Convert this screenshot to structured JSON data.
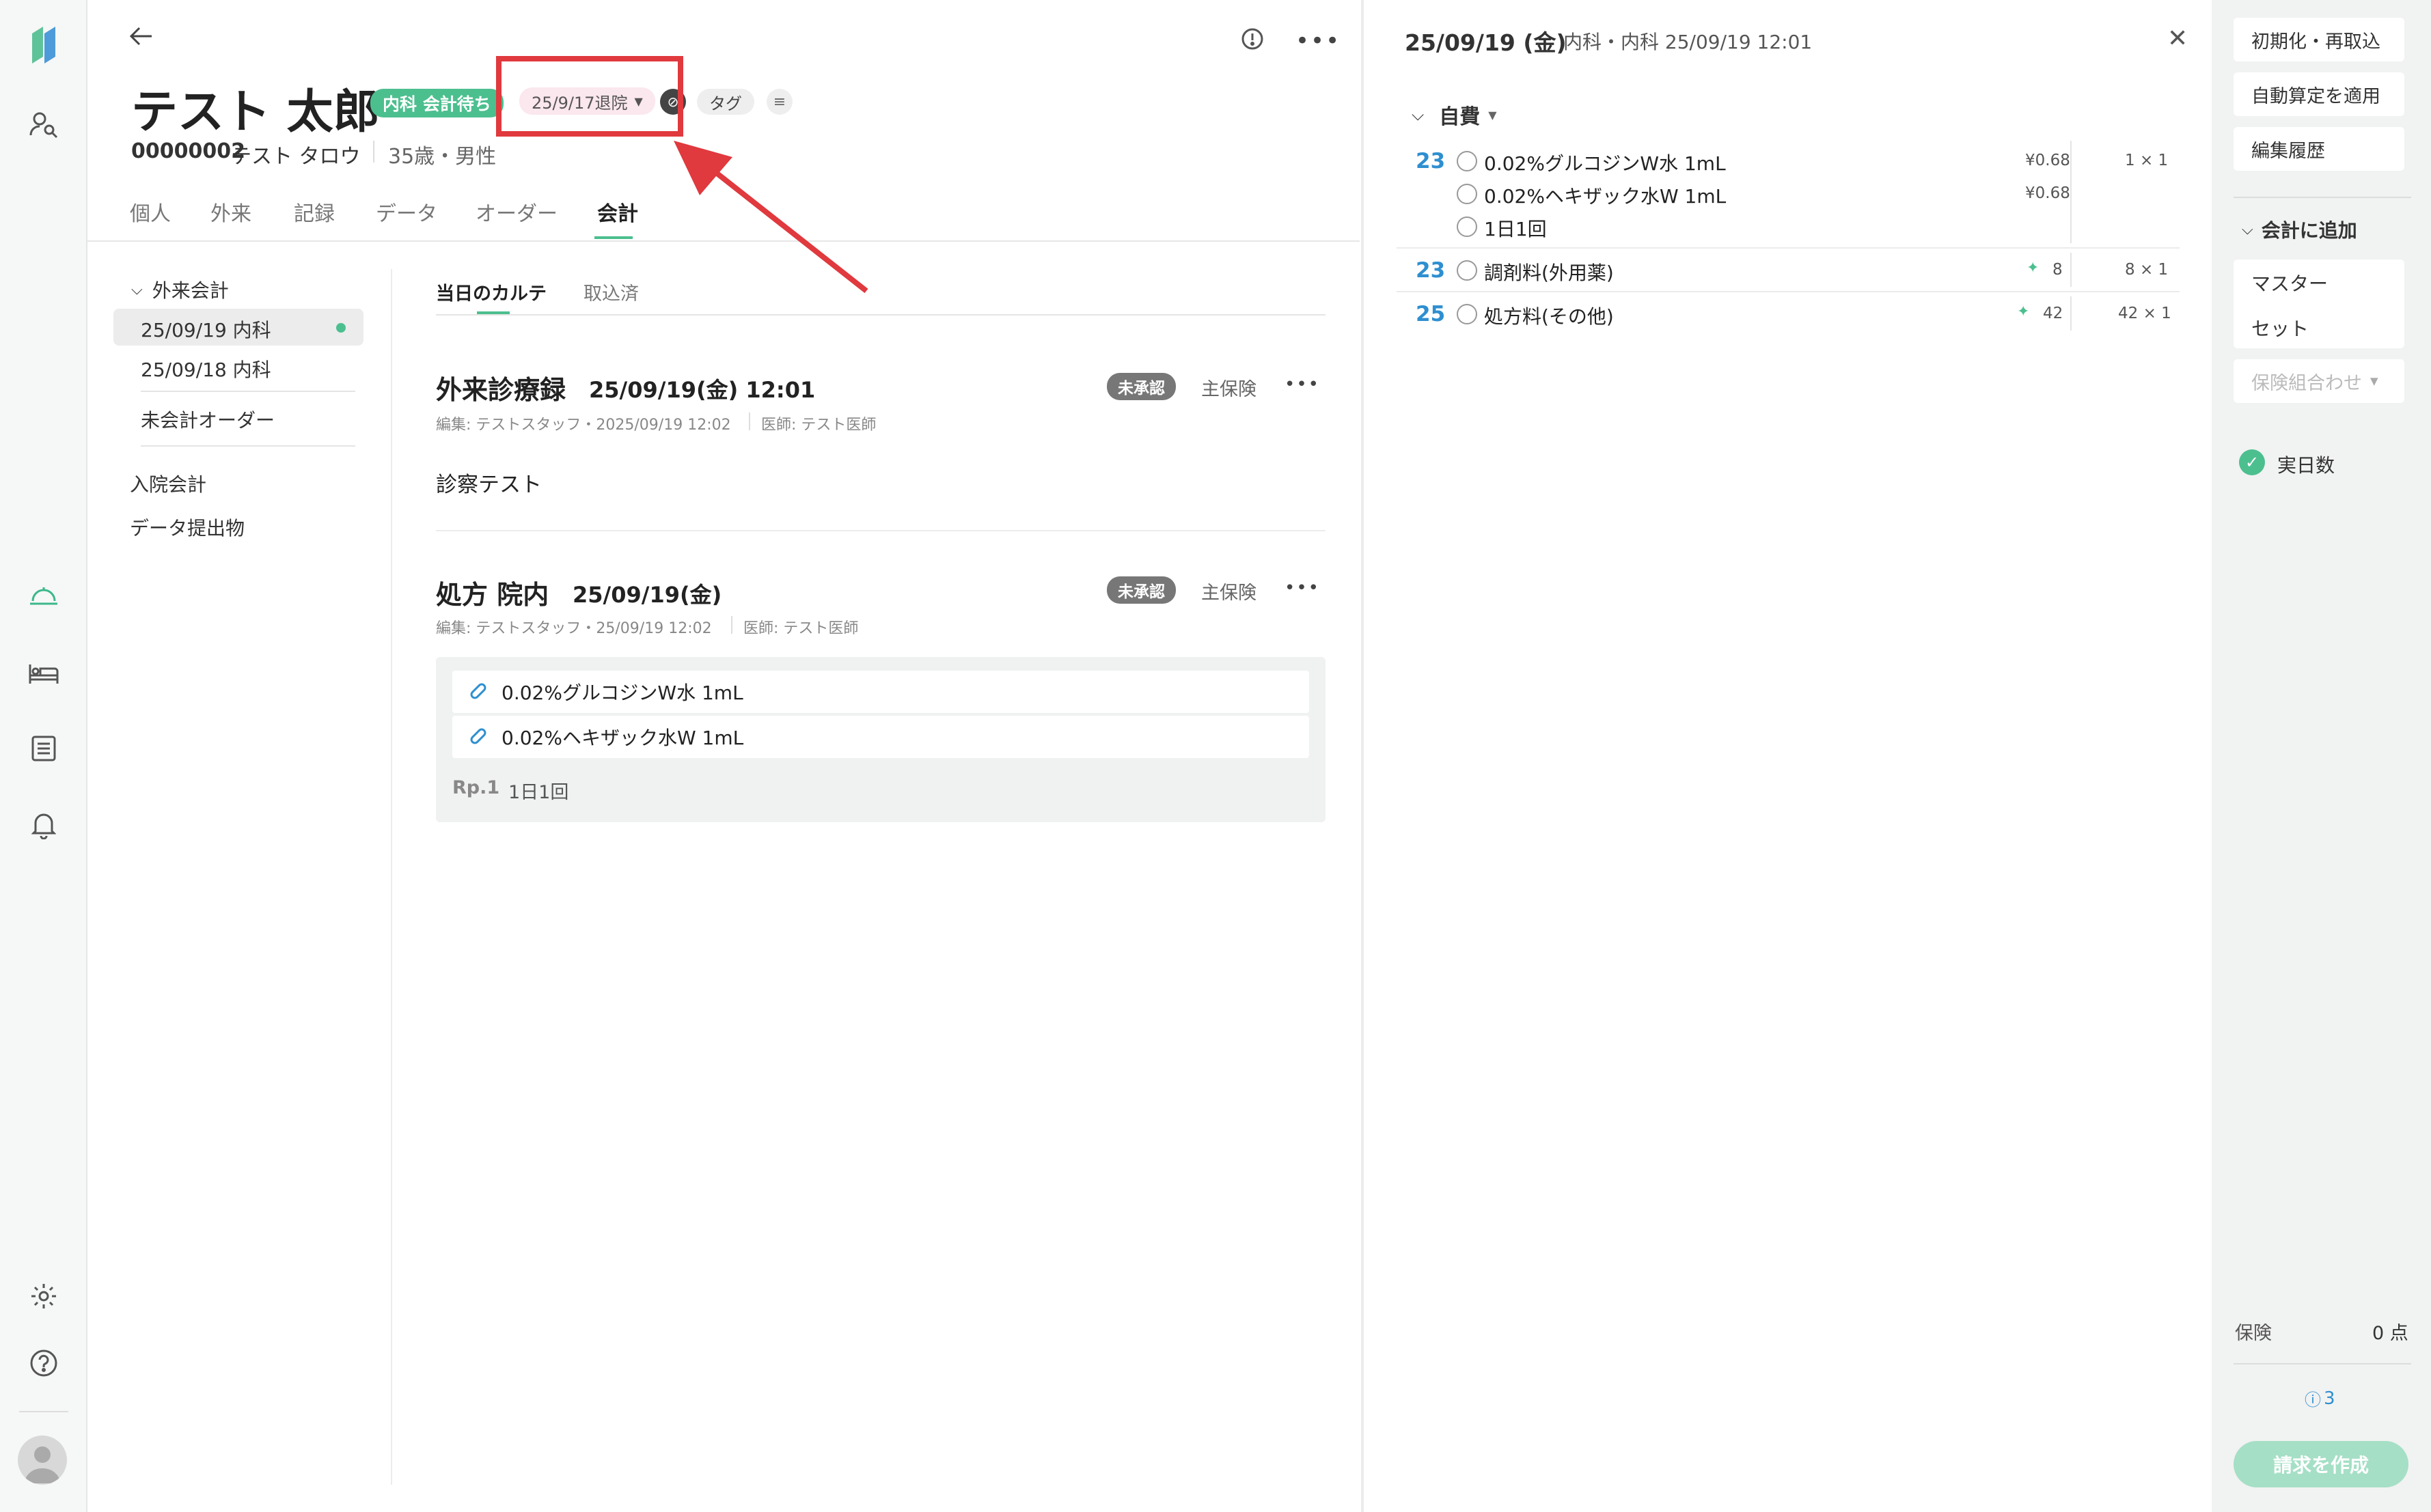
{
  "patient": {
    "name": "テスト 太郎",
    "status_badge": "内科 会計待ち",
    "discharge_chip": "25/9/17退院",
    "tag_label": "タグ",
    "id": "00000002",
    "kana": "テスト タロウ",
    "age_sex": "35歳・男性"
  },
  "tabs": [
    "個人",
    "外来",
    "記録",
    "データ",
    "オーダー",
    "会計"
  ],
  "left_nav": {
    "group_label": "外来会計",
    "items": [
      "25/09/19 内科",
      "25/09/18 内科"
    ],
    "unbilled": "未会計オーダー",
    "inpatient": "入院会計",
    "data_submission": "データ提出物"
  },
  "subtabs": [
    "当日のカルテ",
    "取込済"
  ],
  "card1": {
    "title": "外来診療録",
    "date": "25/09/19(金) 12:01",
    "badge": "未承認",
    "insurance": "主保険",
    "meta_editor": "編集: テストスタッフ・2025/09/19 12:02",
    "meta_doctor": "医師: テスト医師",
    "body": "診察テスト"
  },
  "card2": {
    "title": "処方 院内",
    "date": "25/09/19(金)",
    "badge": "未承認",
    "insurance": "主保険",
    "meta_editor": "編集: テストスタッフ・25/09/19 12:02",
    "meta_doctor": "医師: テスト医師",
    "drugs": [
      "0.02%グルコジンW水 1mL",
      "0.02%ヘキザック水W 1mL"
    ],
    "rp_label": "Rp.1",
    "rp_freq": "1日1回"
  },
  "right_panel": {
    "date": "25/09/19 (金)",
    "subtitle": "内科・内科 25/09/19 12:01",
    "section": "自費",
    "rows": [
      {
        "code": "23",
        "items": [
          "0.02%グルコジンW水 1mL",
          "0.02%ヘキザック水W 1mL",
          "1日1回"
        ],
        "prices": [
          "¥0.68",
          "¥0.68"
        ],
        "qty": "1 × 1"
      },
      {
        "code": "23",
        "items": [
          "調剤料(外用薬)"
        ],
        "points": "8",
        "qty": "8 × 1"
      },
      {
        "code": "25",
        "items": [
          "処方料(その他)"
        ],
        "points": "42",
        "qty": "42 × 1"
      }
    ]
  },
  "side_panel": {
    "btn_reset": "初期化・再取込",
    "btn_auto": "自動算定を適用",
    "btn_history": "編集履歴",
    "add_section": "会計に追加",
    "master": "マスター",
    "set": "セット",
    "insurance_combo": "保険組合わせ",
    "actual_days": "実日数",
    "insurance_label": "保険",
    "insurance_points": "0 点",
    "info_count": "3",
    "create_bill": "請求を作成"
  },
  "colors": {
    "accent_green": "#4cbf8f",
    "badge_gray": "#777",
    "annot_red": "#e0393e",
    "code_blue": "#2e8fd0"
  }
}
